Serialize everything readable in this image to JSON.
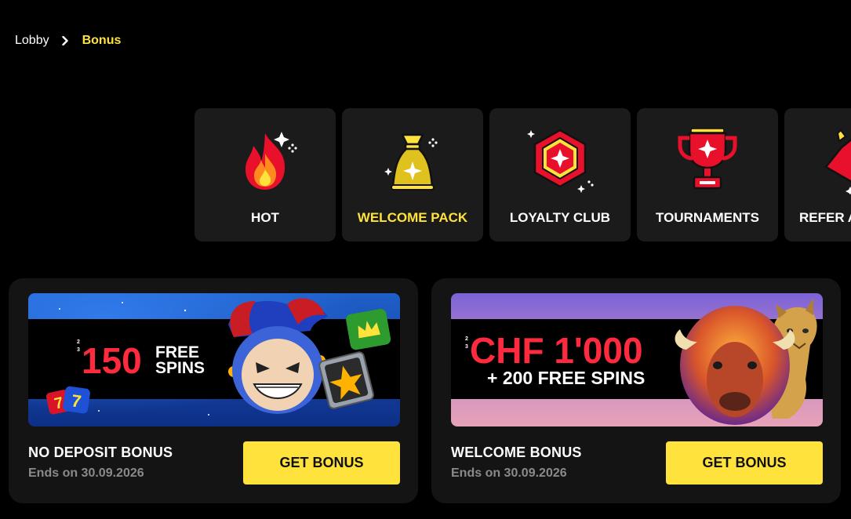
{
  "breadcrumb": {
    "home": "Lobby",
    "current": "Bonus"
  },
  "categories": [
    {
      "label": "HOT",
      "icon": "fire-icon",
      "active": false
    },
    {
      "label": "WELCOME PACK",
      "icon": "money-bag-icon",
      "active": true
    },
    {
      "label": "LOYALTY CLUB",
      "icon": "gem-icon",
      "active": false
    },
    {
      "label": "TOURNAMENTS",
      "icon": "trophy-icon",
      "active": false
    },
    {
      "label": "REFER A",
      "icon": "refer-icon",
      "active": false
    }
  ],
  "bonuses": [
    {
      "banner_amount": "150",
      "banner_line1": "FREE",
      "banner_line2": "SPINS",
      "title": "NO DEPOSIT BONUS",
      "expiry": "Ends on 30.09.2026",
      "button": "GET BONUS"
    },
    {
      "banner_amount": "CHF 1'000",
      "banner_line1": "+ 200 FREE SPINS",
      "title": "WELCOME BONUS",
      "expiry": "Ends on 30.09.2026",
      "button": "GET BONUS"
    }
  ],
  "colors": {
    "accent": "#ffe23b",
    "red": "#e8102a",
    "tile": "#1b1b1b",
    "card": "#141414",
    "muted": "#8a8a8a"
  }
}
